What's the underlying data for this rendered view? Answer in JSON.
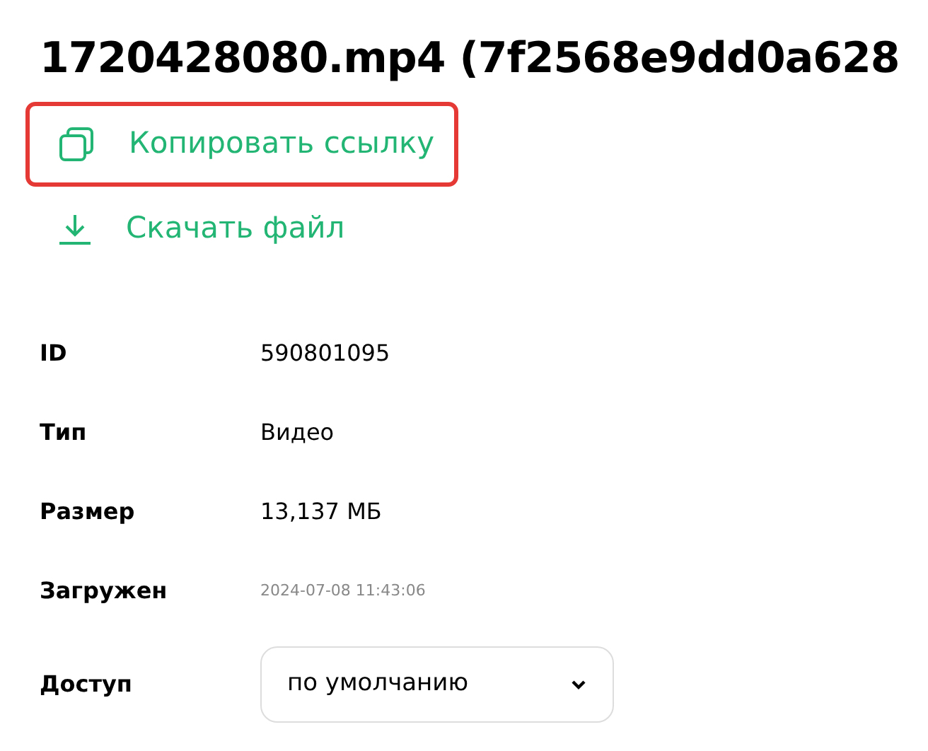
{
  "title": "1720428080.mp4 (7f2568e9dd0a628",
  "actions": [
    {
      "kind": "copy",
      "label": "Копировать ссылку",
      "highlighted": true
    },
    {
      "kind": "download",
      "label": "Скачать файл",
      "highlighted": false
    }
  ],
  "details": [
    {
      "label": "ID",
      "value": "590801095",
      "kind": "text"
    },
    {
      "label": "Тип",
      "value": "Видео",
      "kind": "text"
    },
    {
      "label": "Размер",
      "value": "13,137 МБ",
      "kind": "text"
    },
    {
      "label": "Загружен",
      "value": "2024-07-08 11:43:06",
      "kind": "timestamp"
    },
    {
      "label": "Доступ",
      "value": "по умолчанию",
      "kind": "select"
    }
  ]
}
